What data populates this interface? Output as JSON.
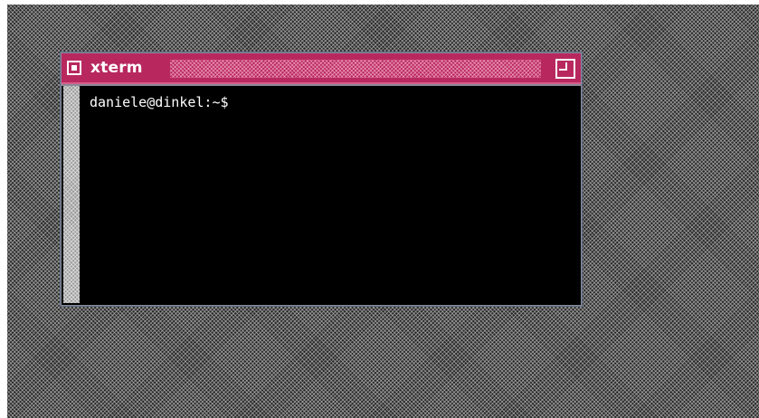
{
  "window": {
    "title": "xterm",
    "close_icon": "close-icon",
    "maximize_icon": "maximize-icon"
  },
  "terminal": {
    "prompt": "daniele@dinkel:~$"
  },
  "colors": {
    "titlebar": "#b8285f",
    "terminal_bg": "#000000",
    "terminal_fg": "#ffffff",
    "window_border": "#5b6a86"
  }
}
